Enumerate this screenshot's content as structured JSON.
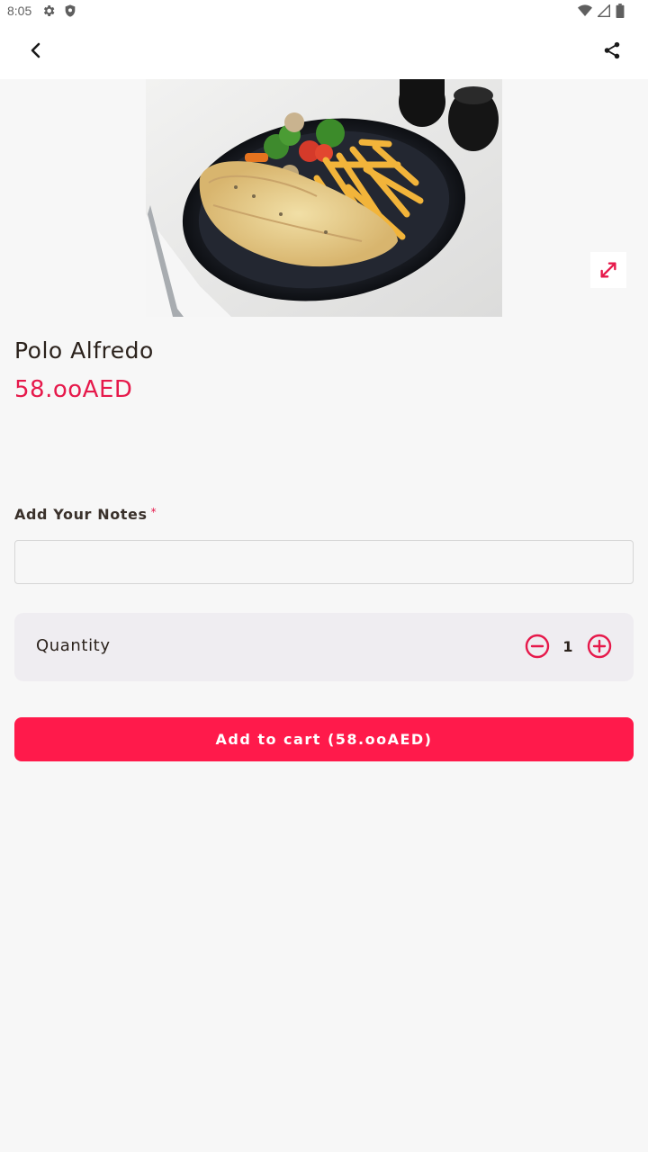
{
  "status_bar": {
    "time": "8:05",
    "left_icons": [
      "settings-gear-icon",
      "shield-icon"
    ],
    "right_icons": [
      "wifi-icon",
      "cell-signal-icon",
      "battery-icon"
    ]
  },
  "app_bar": {
    "back_icon": "chevron-left-icon",
    "share_icon": "share-icon"
  },
  "product": {
    "image_alt": "Polo Alfredo",
    "name": "Polo Alfredo",
    "price": "58.ooAED",
    "expand_icon": "expand-icon"
  },
  "notes": {
    "label": "Add Your Notes",
    "required_marker": "*",
    "value": "",
    "placeholder": ""
  },
  "quantity": {
    "label": "Quantity",
    "value": "1",
    "minus_icon": "minus-circle-icon",
    "plus_icon": "plus-circle-icon"
  },
  "cart": {
    "button_label": "Add to cart (58.ooAED)"
  },
  "colors": {
    "accent": "#ff1a4b",
    "price": "#e6194b",
    "text": "#2b221c",
    "card_bg": "#efedf1",
    "page_bg": "#f7f7f7"
  }
}
